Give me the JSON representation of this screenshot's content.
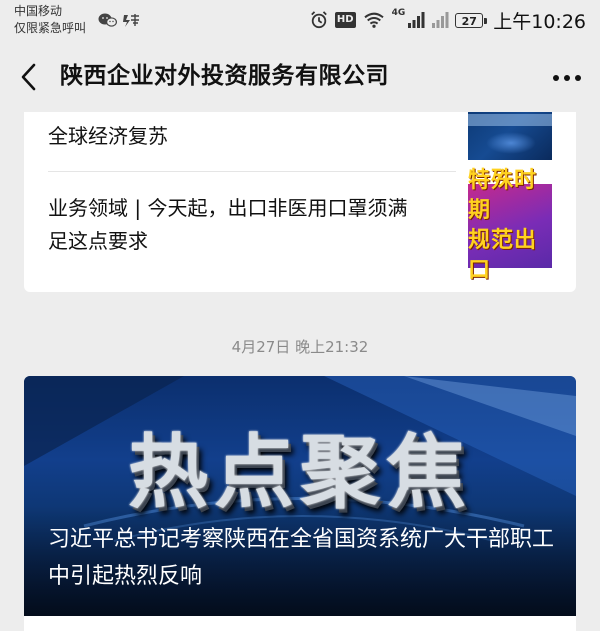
{
  "status_bar": {
    "carrier_line1": "中国移动",
    "carrier_line2": "仅限紧急呼叫",
    "hd_label": "HD",
    "network_label": "4G",
    "battery_level": "27",
    "time": "上午10:26",
    "icons": [
      "wechat-icon",
      "alarm-icon",
      "hd-icon",
      "wifi-icon",
      "signal-icon",
      "battery-icon"
    ]
  },
  "nav": {
    "title": "陕西企业对外投资服务有限公司",
    "back_icon": "chevron-left-icon",
    "more_icon": "more-dots-icon"
  },
  "articles": [
    {
      "title": "全球经济复苏"
    },
    {
      "title_line1": "业务领域 | 今天起，出口非医用口罩须满",
      "title_line2": "足这点要求",
      "thumb_line1": "特殊时期",
      "thumb_line2": "规范出口"
    }
  ],
  "date_label": "4月27日 晚上21:32",
  "feature": {
    "headline": "热点聚焦",
    "caption": "习近平总书记考察陕西在全省国资系统广大干部职工中引起热烈反响"
  },
  "colors": {
    "background": "#ededed",
    "card": "#ffffff",
    "thumb_text": "#ffd21f",
    "feature_bg": "#123f8c"
  }
}
